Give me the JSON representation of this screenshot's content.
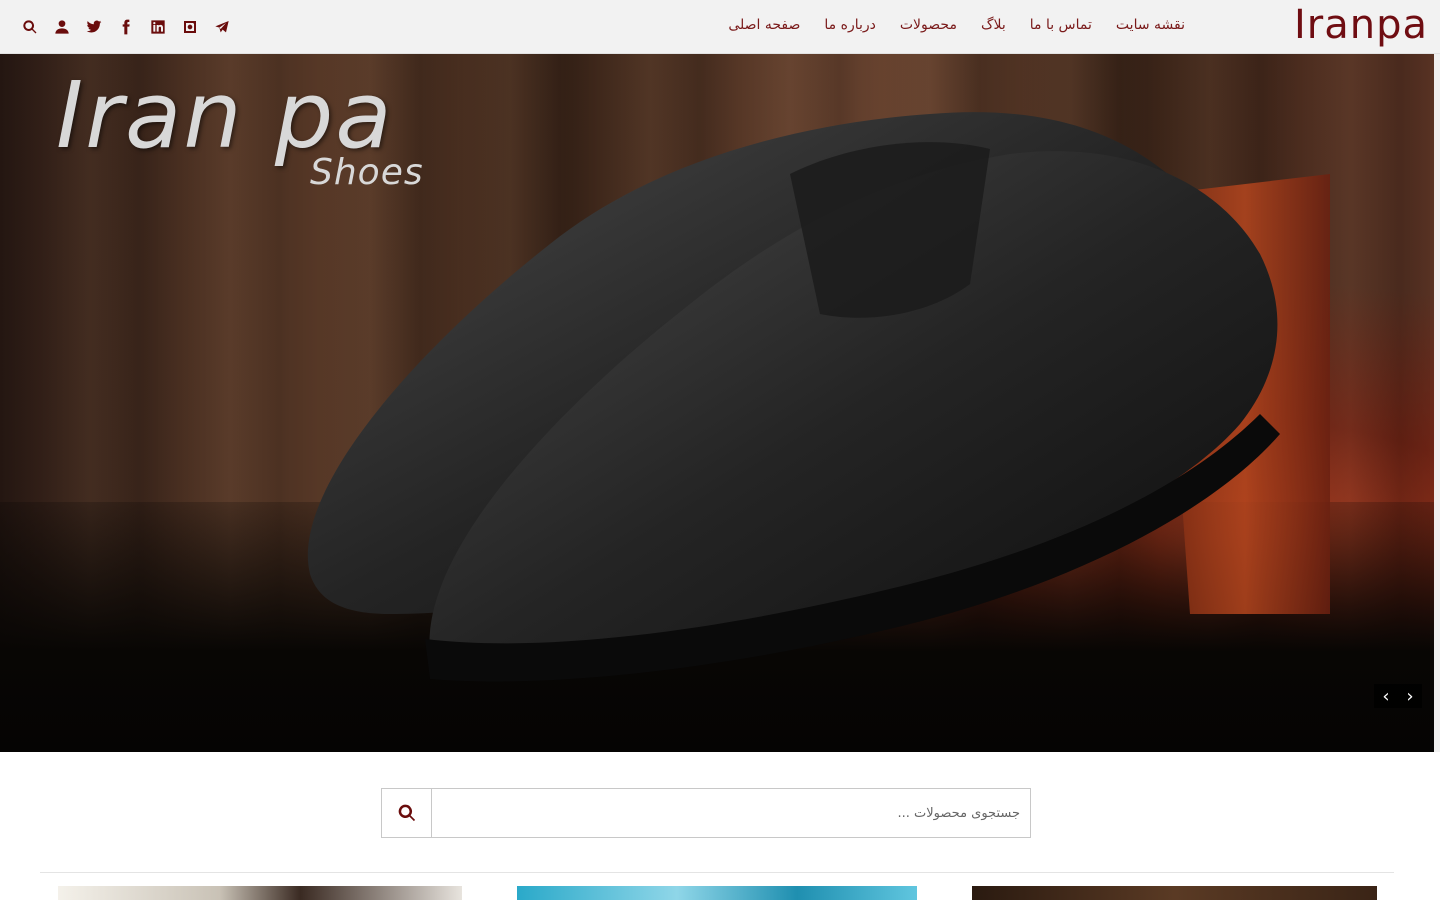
{
  "header": {
    "logo_text": "Iranpa",
    "nav": [
      {
        "label": "صفحه اصلی"
      },
      {
        "label": "درباره ما"
      },
      {
        "label": "محصولات"
      },
      {
        "label": "بلاگ"
      },
      {
        "label": "تماس با ما"
      },
      {
        "label": "نقشه سایت"
      }
    ],
    "icons": [
      "search-icon",
      "user-icon",
      "twitter-icon",
      "facebook-icon",
      "linkedin-icon",
      "instagram-icon",
      "telegram-icon"
    ]
  },
  "hero": {
    "brand_main": "Iran pa",
    "brand_sub": "Shoes",
    "prev_label": "‹",
    "next_label": "›"
  },
  "search": {
    "placeholder": "جستجوی محصولات ..."
  },
  "colors": {
    "accent": "#6a0c0c",
    "nav_text": "#7a1a1a",
    "header_bg": "#f2f2f2"
  }
}
